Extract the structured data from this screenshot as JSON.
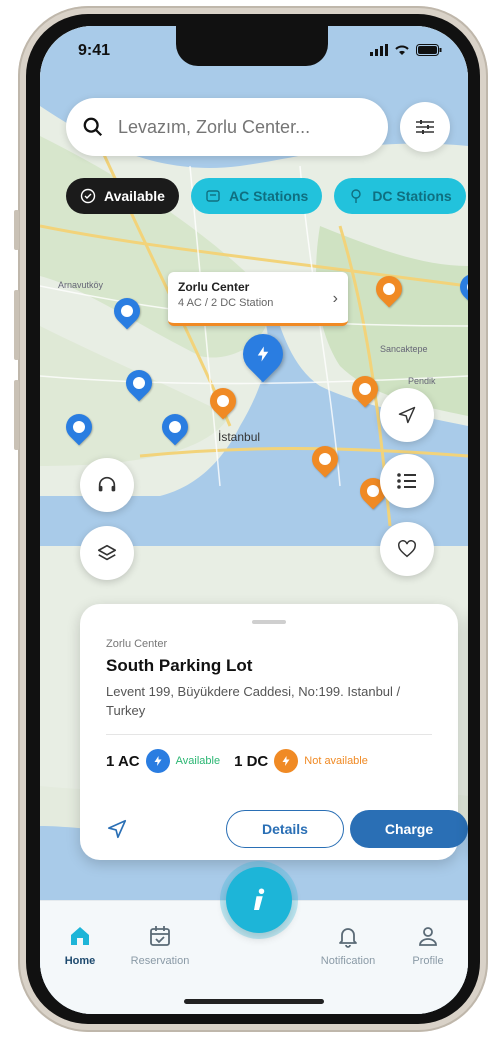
{
  "status_bar": {
    "time": "9:41"
  },
  "search": {
    "placeholder": "Levazım, Zorlu Center..."
  },
  "chips": [
    {
      "label": "Available"
    },
    {
      "label": "AC Stations"
    },
    {
      "label": "DC Stations"
    }
  ],
  "map": {
    "labels": [
      "Arnavutköy",
      "İstanbul",
      "Sancaktepe",
      "Pendik"
    ],
    "callout": {
      "title": "Zorlu Center",
      "subtitle": "4 AC / 2 DC Station"
    }
  },
  "station_card": {
    "subtitle": "Zorlu Center",
    "title": "South Parking Lot",
    "address": "Levent 199, Büyükdere Caddesi, No:199. Istanbul / Turkey",
    "ac": {
      "label": "1 AC",
      "status": "Available"
    },
    "dc": {
      "label": "1 DC",
      "status": "Not available"
    },
    "details_label": "Details",
    "charge_label": "Charge"
  },
  "tabbar": {
    "home": "Home",
    "reservation": "Reservation",
    "notification": "Notification",
    "profile": "Profile"
  },
  "colors": {
    "primary": "#2a6fb5",
    "teal": "#22c2dc",
    "orange": "#f08a24",
    "blue": "#2a7de1",
    "green": "#2bb673"
  }
}
